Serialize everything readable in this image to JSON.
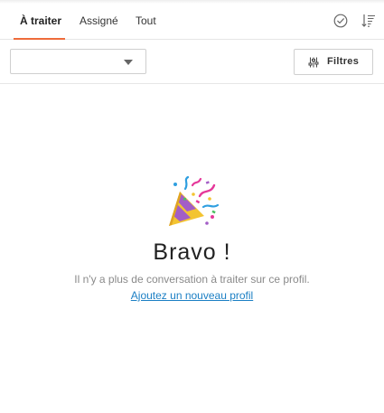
{
  "tabs": [
    {
      "label": "À traiter",
      "active": true
    },
    {
      "label": "Assigné",
      "active": false
    },
    {
      "label": "Tout",
      "active": false
    }
  ],
  "header_icons": [
    "check-circle-icon",
    "sort-icon"
  ],
  "toolbar": {
    "select_value": "",
    "filters_label": "Filtres",
    "filters_icon": "sliders-icon"
  },
  "empty_state": {
    "icon": "party-popper-icon",
    "title": "Bravo !",
    "message": "Il n'y a plus de conversation à traiter sur ce profil.",
    "link": "Ajoutez un nouveau profil"
  },
  "colors": {
    "accent": "#ee6b3b",
    "link": "#1b7fc4",
    "muted_text": "#8a8a8a"
  }
}
